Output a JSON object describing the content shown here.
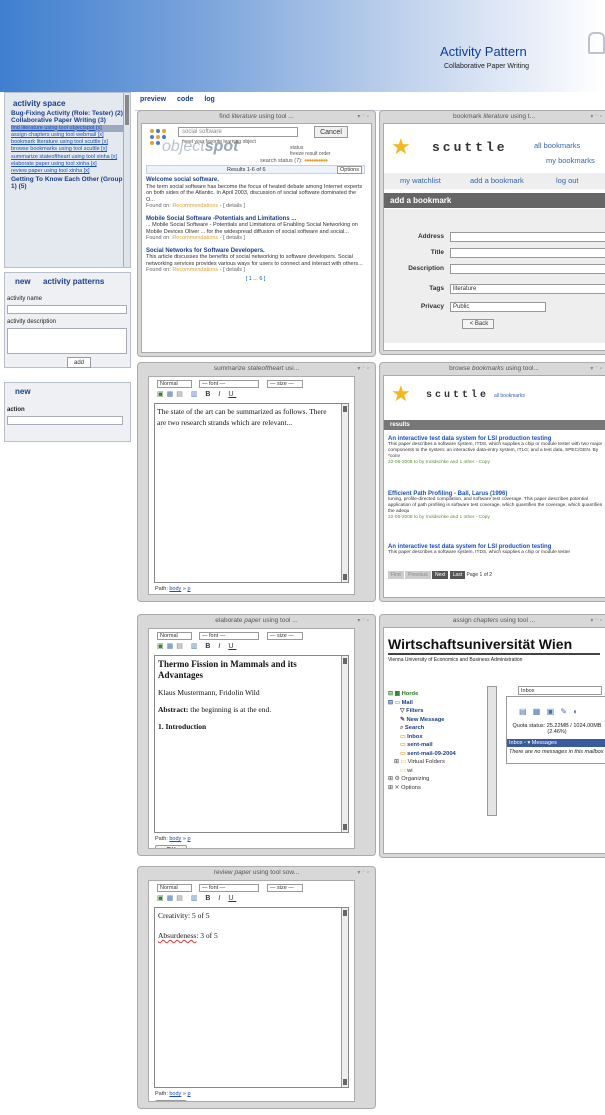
{
  "header": {
    "title": "Activity Pattern",
    "subtitle": "Collaborative Paper Writing"
  },
  "sidebar": {
    "activity_space_tab": "activity space",
    "items": [
      {
        "label": "Bug-Fixing Activity (Role: Tester) (2)",
        "type": "bold"
      },
      {
        "label": "Collaborative Paper Writing (3)",
        "type": "bold"
      },
      {
        "label": "find literature using tool objectspot [x]",
        "type": "selected"
      },
      {
        "label": "assign chapters using tool webmail [x]",
        "type": "link"
      },
      {
        "label": "bookmark literature using tool scuttle [x]",
        "type": "link"
      },
      {
        "label": "browse bookmarks using tool scuttle [x]",
        "type": "link"
      },
      {
        "label": "summarize stateoftheart using tool xinha [x]",
        "type": "link"
      },
      {
        "label": "elaborate paper using tool xinha [x]",
        "type": "link"
      },
      {
        "label": "review paper using tool xinha [x]",
        "type": "link"
      },
      {
        "label": "Getting To Know Each Other (Group 1) (5)",
        "type": "bold"
      }
    ],
    "new_tab": "new",
    "patterns_tab": "activity patterns",
    "activity_name_label": "activity name",
    "activity_description_label": "activity description",
    "add_button": "add",
    "new2_tab": "new",
    "action_label": "action"
  },
  "main_tabs": [
    "preview",
    "code",
    "log"
  ],
  "widgets": {
    "find": {
      "title_pre": "find",
      "title_em": "literature",
      "title_post": "using tool ...",
      "search_value": "social software",
      "cancel": "Cancel",
      "hint1": "meet your favorite learning object",
      "hint2": "status",
      "hint3": "freeze result order",
      "status": "search status (7):",
      "results_header": "Results 1-6 of 6",
      "options": "Options",
      "results": [
        {
          "num": "#1:",
          "title": "Welcome social software.",
          "body": "The term social software has become the focus of heated debate among Internet experts on both sides of the Atlantic. In April 2003, discussion of social software dominated the O...",
          "found": "Found on:",
          "src": "Recommendations",
          "details": "- [ details ]"
        },
        {
          "num": "#2:",
          "title": "Mobile Social Software -Potentials and Limitations ...",
          "body": "... Mobile Social Software - Potentials and Limitations of Enabling Social Networking on Mobile Devices Oliver ... for the widespread diffusion of social software and social...",
          "found": "Found on:",
          "src": "Recommendations",
          "details": "- [ details ]"
        },
        {
          "num": "#3:",
          "title": "Social Networks for Software Developers.",
          "body": "This article discusses the benefits of social networking to software developers. Social networking services provides various ways for users to connect and interact with others...",
          "found": "Found on:",
          "src": "Recommendations",
          "details": "- [ details ]"
        }
      ],
      "pager": "[ 1 ... 6 ]"
    },
    "bookmark": {
      "title_pre": "bookmark",
      "title_em": "literature",
      "title_post": "using t...",
      "brand": "scuttle",
      "all_bookmarks": "all bookmarks",
      "my_bookmarks": "my bookmarks",
      "watchlist": "my watchlist",
      "add_link": "add a bookmark",
      "logout": "log out",
      "add_header": "add a bookmark",
      "fields": {
        "address": "Address",
        "title": "Title",
        "description": "Description",
        "tags": "Tags",
        "tags_value": "literature",
        "privacy": "Privacy",
        "privacy_value": "Public",
        "back": "< Back"
      }
    },
    "summarize": {
      "title_pre": "summarize",
      "title_em": "stateoftheart",
      "title_post": "usi...",
      "fmt": "Normal",
      "font": "— font —",
      "size": "— size —",
      "text": "The state of the art can be summarized as follows. There are two research strands which are relevant...",
      "path_label": "Path:",
      "path_body": "body",
      "path_p": "p",
      "ok": "OK"
    },
    "browse": {
      "title_pre": "browse",
      "title_em": "bookmarks",
      "title_post": "using tool...",
      "brand": "scuttle",
      "all_bookmarks": "all bookmarks",
      "results_label": "results",
      "items": [
        {
          "title": "An interactive test data system for LSI production testing",
          "body": "This paper describes a software system, ITDS, which supplies a chip or module tester with two major components to the system: an interactive data-entry system, ITLG; and a test data, SPEC/GEN. By *conv",
          "footer": "22-05-2008 to by rnoldschke and 1 other - Copy"
        },
        {
          "title": "Efficient Path Profiling - Ball, Larus (1996)",
          "body": "tuning, profile-directed compilation, and software test coverage. This paper describes potential application of path profiling is software test coverage, which quantifies the coverage, which quantifies the adequ",
          "footer": "22-05-2008 to by rnoldschke and 1 other - Copy"
        },
        {
          "title": "An interactive test data system for LSI production testing",
          "body": "This paper describes a software system, ITDS, which supplies a chip or module tester",
          "footer": ""
        }
      ],
      "pager_first": "First",
      "pager_prev": "Previous",
      "pager_next": "Next",
      "pager_last": "Last",
      "pager_page": "Page 1 of 2"
    },
    "elaborate": {
      "title_pre": "elaborate",
      "title_em": "paper",
      "title_post": "using tool ...",
      "fmt": "Normal",
      "font": "— font —",
      "size": "— size —",
      "heading": "Thermo Fission in Mammals and its Advantages",
      "authors": "Klaus Mustermann, Fridolin Wild",
      "abstract_label": "Abstract:",
      "abstract_text": "the beginning is at the end.",
      "intro": "1. Introduction",
      "path_label": "Path:",
      "path_body": "body",
      "path_p": "p",
      "ok": "OK"
    },
    "assign": {
      "title_pre": "assign",
      "title_em": "chapters",
      "title_post": "using tool ...",
      "uni": "Wirtschaftsuniversität Wien",
      "uni_sub": "Vienna University of Economics and Business Administration",
      "tree": [
        "Horde",
        "Mail",
        "Filters",
        "New Message",
        "Search",
        "Inbox",
        "sent-mail",
        "sent-mail-09-2004",
        "Virtual Folders",
        "wi",
        "Organizing",
        "Options"
      ],
      "inbox_select": "Inbox",
      "quota": "Quota status: 25.22MB / 1024.00MB (2.46%)",
      "inbox_label": "Inbox",
      "messages_label": "Messages",
      "empty": "There are no messages in this mailbox"
    },
    "review": {
      "title_pre": "review",
      "title_em": "paper",
      "title_post": "using tool sow...",
      "fmt": "Normal",
      "font": "— font —",
      "size": "— size —",
      "line1": "Creativity: 5 of 5",
      "line2_a": "Absurdeness",
      "line2_b": ": 3 of 5",
      "path_label": "Path:",
      "path_body": "body",
      "path_p": "p",
      "ok": "OK"
    }
  }
}
